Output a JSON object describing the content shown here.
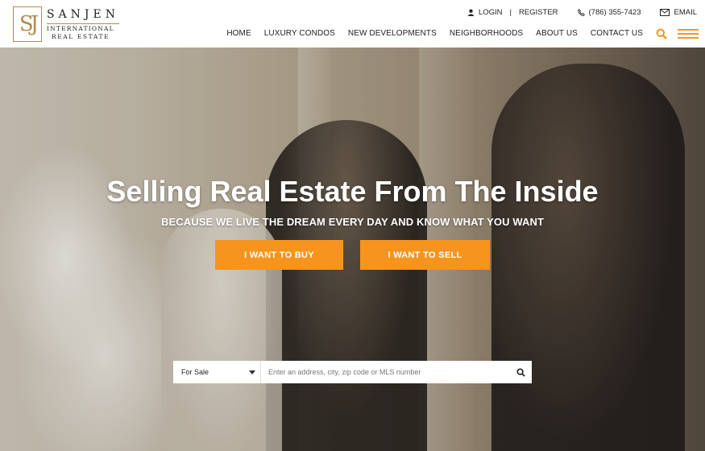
{
  "logo": {
    "mark": "SJ",
    "line1": "SANJEN",
    "line2": "INTERNATIONAL",
    "line3": "REAL ESTATE"
  },
  "topbar": {
    "login": "LOGIN",
    "register": "REGISTER",
    "phone": "(786) 355-7423",
    "email": "EMAIL",
    "divider": "|"
  },
  "nav": {
    "items": [
      "HOME",
      "LUXURY CONDOS",
      "NEW DEVELOPMENTS",
      "NEIGHBORHOODS",
      "ABOUT US",
      "CONTACT US"
    ]
  },
  "hero": {
    "title": "Selling Real Estate From The Inside",
    "subtitle": "BECAUSE WE LIVE THE DREAM EVERY DAY AND KNOW WHAT YOU WANT",
    "buy_label": "I WANT TO BUY",
    "sell_label": "I WANT TO SELL"
  },
  "search": {
    "select_value": "For Sale",
    "placeholder": "Enter an address, city, zip code or MLS number"
  },
  "colors": {
    "accent": "#f7941d",
    "gold": "#b58a4a"
  }
}
